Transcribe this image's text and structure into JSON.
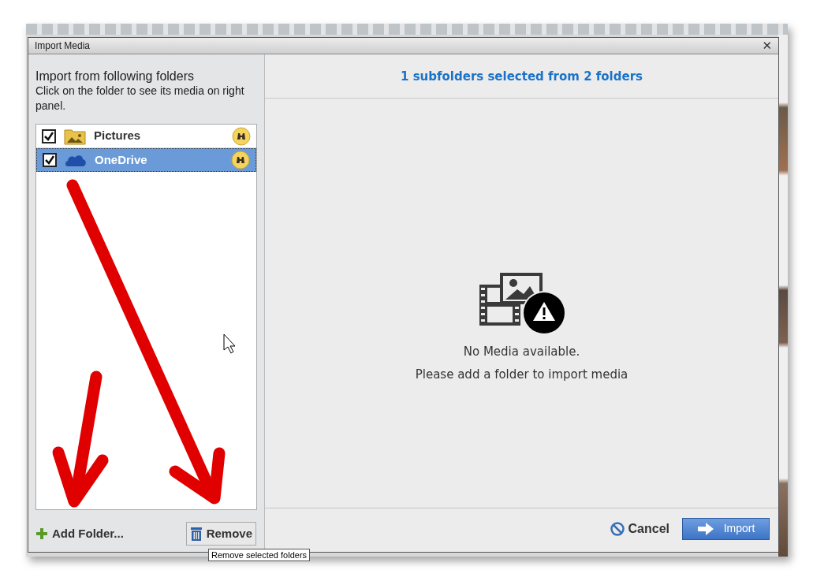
{
  "window": {
    "title": "Import Media",
    "close": "✕"
  },
  "left_panel": {
    "heading": "Import from following folders",
    "instructions": "Click on the folder to see its media on right panel.",
    "folders": [
      {
        "name": "Pictures",
        "kind": "pictures",
        "checked": true,
        "selected": false
      },
      {
        "name": "OneDrive",
        "kind": "cloud",
        "checked": true,
        "selected": true
      }
    ],
    "add_button": "Add Folder...",
    "remove_button": "Remove",
    "tooltip": "Remove selected folders"
  },
  "right_panel": {
    "summary": "1 subfolders selected from 2 folders",
    "empty_title": "No Media available.",
    "empty_hint": "Please add a folder to import media"
  },
  "footer": {
    "cancel": "Cancel",
    "import": "Import"
  }
}
